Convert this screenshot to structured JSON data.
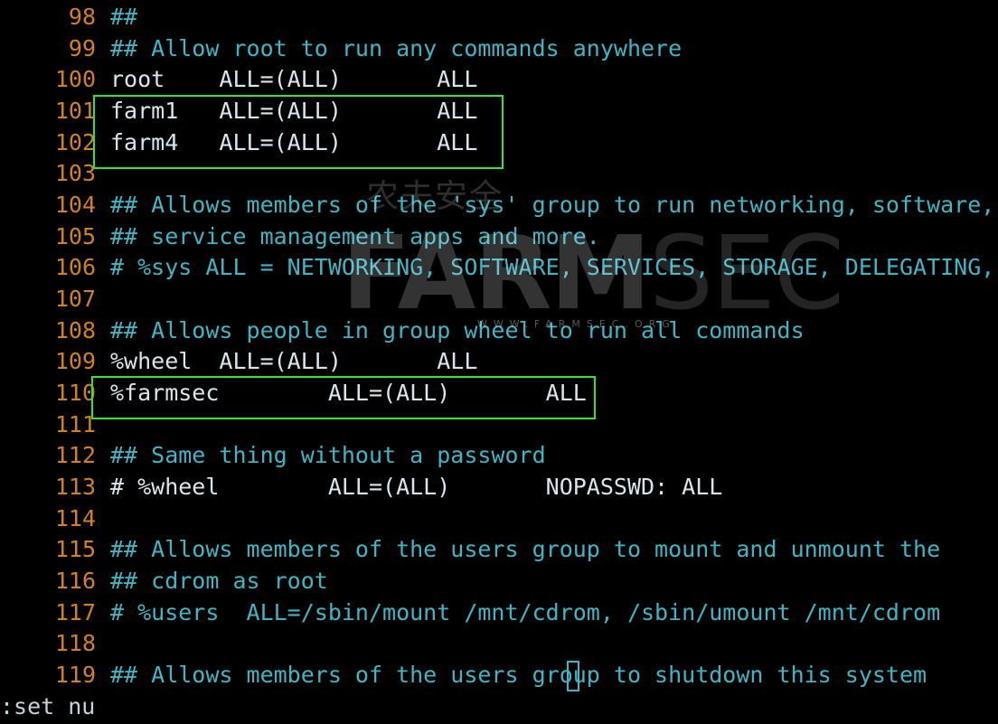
{
  "editor": {
    "lines": [
      {
        "num": "98",
        "text": "##"
      },
      {
        "num": "99",
        "text": "## Allow root to run any commands anywhere"
      },
      {
        "num": "100",
        "text": "root    ALL=(ALL)       ALL"
      },
      {
        "num": "101",
        "text": "farm1   ALL=(ALL)       ALL"
      },
      {
        "num": "102",
        "text": "farm4   ALL=(ALL)       ALL"
      },
      {
        "num": "103",
        "text": ""
      },
      {
        "num": "104",
        "text": "## Allows members of the 'sys' group to run networking, software,"
      },
      {
        "num": "105",
        "text": "## service management apps and more."
      },
      {
        "num": "106",
        "text": "# %sys ALL = NETWORKING, SOFTWARE, SERVICES, STORAGE, DELEGATING,"
      },
      {
        "num": "107",
        "text": ""
      },
      {
        "num": "108",
        "text": "## Allows people in group wheel to run all commands"
      },
      {
        "num": "109",
        "text": "%wheel  ALL=(ALL)       ALL"
      },
      {
        "num": "110",
        "text": "%farmsec        ALL=(ALL)       ALL"
      },
      {
        "num": "111",
        "text": ""
      },
      {
        "num": "112",
        "text": "## Same thing without a password"
      },
      {
        "num": "113",
        "text": "# %wheel        ALL=(ALL)       NOPASSWD: ALL"
      },
      {
        "num": "114",
        "text": ""
      },
      {
        "num": "115",
        "text": "## Allows members of the users group to mount and unmount the"
      },
      {
        "num": "116",
        "text": "## cdrom as root"
      },
      {
        "num": "117",
        "text": "# %users  ALL=/sbin/mount /mnt/cdrom, /sbin/umount /mnt/cdrom"
      },
      {
        "num": "118",
        "text": ""
      },
      {
        "num": "119",
        "text": "## Allows members of the users group to shutdown this system"
      }
    ]
  },
  "status_line": ":set nu",
  "watermark": {
    "chinese": "农夫安全",
    "brand_bold": "FARM",
    "brand_thin": "SEC",
    "url": "WWW.FARMSEC.ORG"
  },
  "colors": {
    "background": "#000000",
    "line_number": "#d1821f",
    "code_text": "#3fb6c4",
    "highlight_box": "#2ee62e"
  }
}
